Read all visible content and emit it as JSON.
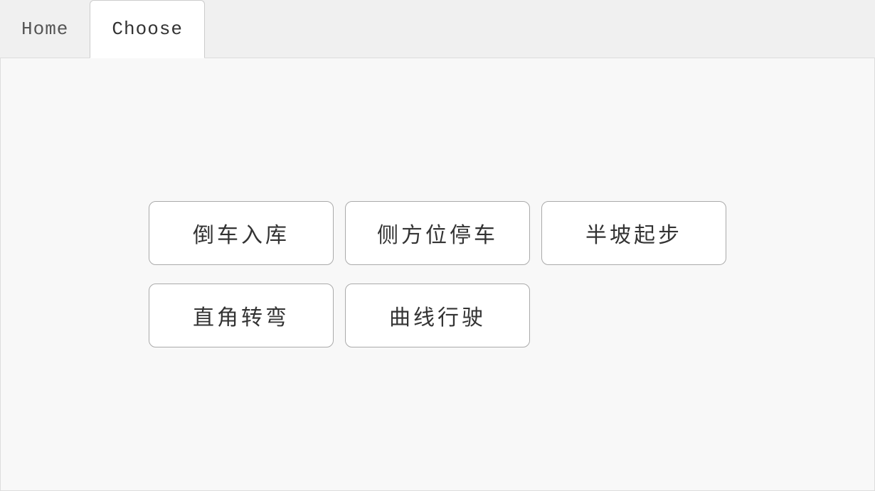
{
  "nav": {
    "home_label": "Home",
    "choose_label": "Choose"
  },
  "buttons": {
    "row1": [
      {
        "id": "daoche-ruku",
        "label": "倒车入库"
      },
      {
        "id": "cefangwei-tingche",
        "label": "侧方位停车"
      },
      {
        "id": "banpo-qibu",
        "label": "半坡起步"
      }
    ],
    "row2": [
      {
        "id": "zhijiao-zhuanwan",
        "label": "直角转弯"
      },
      {
        "id": "quxian-xingshi",
        "label": "曲线行驶"
      },
      {
        "id": "empty",
        "label": ""
      }
    ]
  }
}
